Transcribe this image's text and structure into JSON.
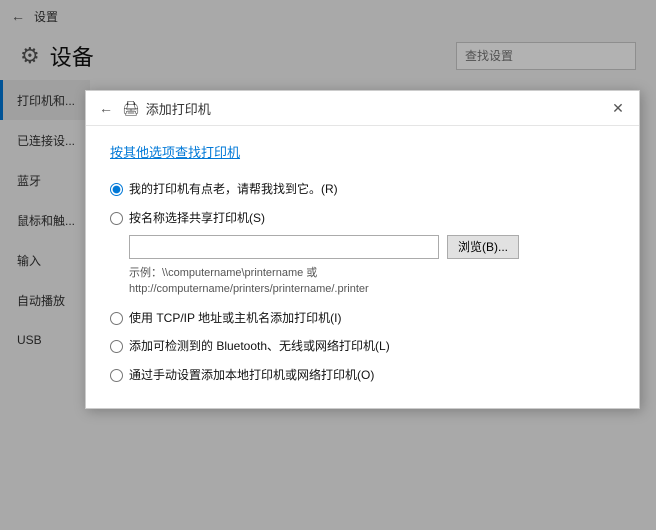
{
  "titlebar": {
    "back_label": "←",
    "title": "设置"
  },
  "header": {
    "title": "设备",
    "search_placeholder": "查找设置"
  },
  "nav": {
    "items": [
      {
        "label": "打印机和..."
      },
      {
        "label": "已连接设..."
      },
      {
        "label": "蓝牙"
      },
      {
        "label": "鼠标和触..."
      },
      {
        "label": "输入"
      },
      {
        "label": "自动播放"
      },
      {
        "label": "USB"
      }
    ]
  },
  "modal": {
    "back_icon": "←",
    "printer_icon": "🖨",
    "title": "添加打印机",
    "close_icon": "✕",
    "link": "按其他选项查找打印机",
    "options": [
      {
        "id": "opt1",
        "label": "我的打印机有点老，请帮我找到它。(R)",
        "checked": true,
        "has_input": false
      },
      {
        "id": "opt2",
        "label": "按名称选择共享打印机(S)",
        "checked": false,
        "has_input": true,
        "input_placeholder": "",
        "browse_label": "浏览(B)...",
        "example": "示例：\\\\computername\\printername 或\nhttp://computername/printers/printername/.printer"
      },
      {
        "id": "opt3",
        "label": "使用 TCP/IP 地址或主机名添加打印机(I)",
        "checked": false,
        "has_input": false
      },
      {
        "id": "opt4",
        "label": "添加可检测到的 Bluetooth、无线或网络打印机(L)",
        "checked": false,
        "has_input": false
      },
      {
        "id": "opt5",
        "label": "通过手动设置添加本地打印机或网络打印机(O)",
        "checked": false,
        "has_input": false
      }
    ]
  }
}
